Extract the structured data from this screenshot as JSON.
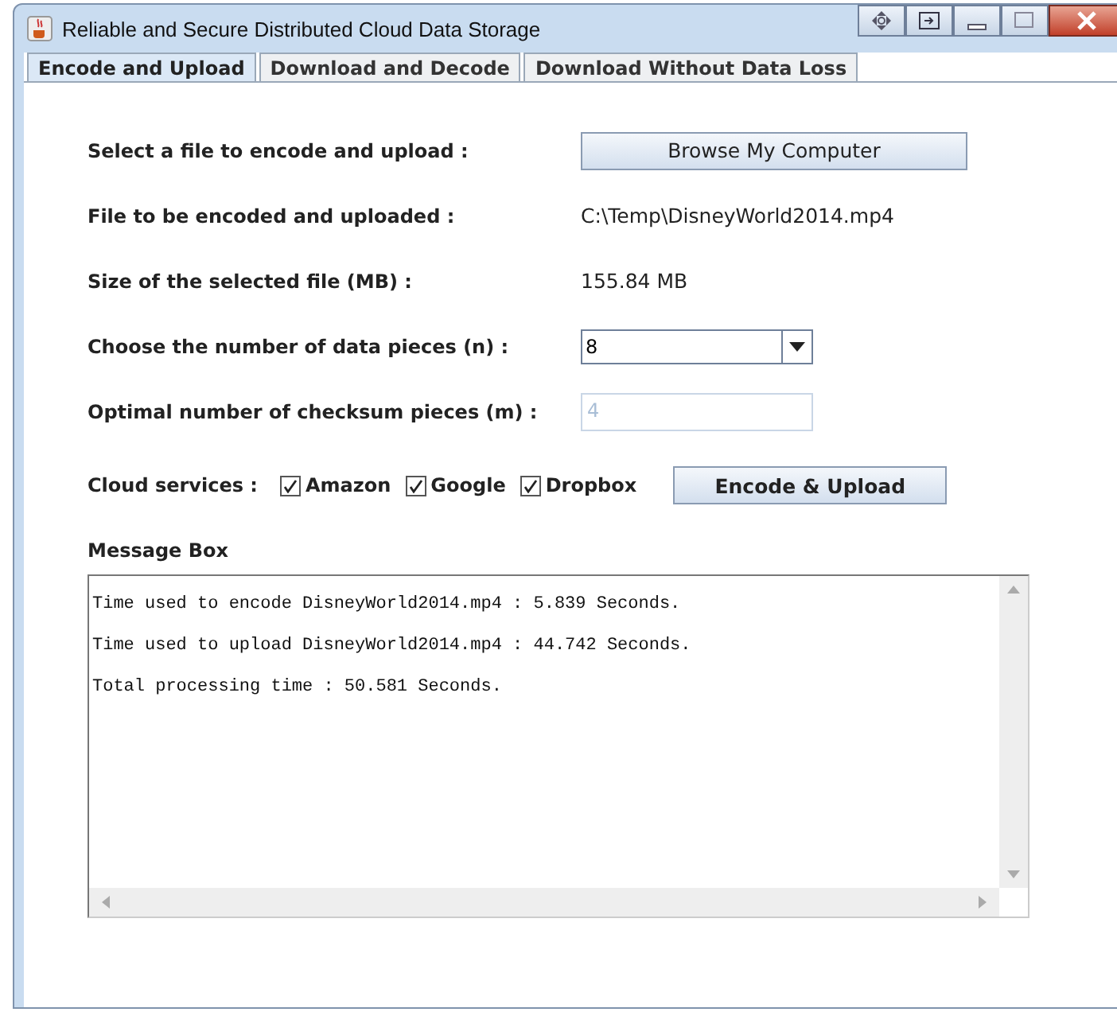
{
  "window": {
    "title": "Reliable and Secure Distributed Cloud Data Storage"
  },
  "tabs": [
    {
      "label": "Encode and Upload",
      "selected": true
    },
    {
      "label": "Download and Decode",
      "selected": false
    },
    {
      "label": "Download Without Data Loss",
      "selected": false
    }
  ],
  "form": {
    "select_label": "Select a file to encode and upload :",
    "browse_button": "Browse My Computer",
    "file_label": "File to be encoded and uploaded :",
    "file_value": "C:\\Temp\\DisneyWorld2014.mp4",
    "size_label": "Size of the selected file (MB) :",
    "size_value": "155.84 MB",
    "pieces_label": "Choose the number of data pieces (n) :",
    "pieces_value": "8",
    "checksum_label": "Optimal number of checksum pieces (m) :",
    "checksum_value": "4",
    "checksum_disabled": true
  },
  "cloud_label": "Cloud services :",
  "services": [
    {
      "label": "Amazon",
      "checked": true
    },
    {
      "label": "Google",
      "checked": true
    },
    {
      "label": "Dropbox",
      "checked": true
    }
  ],
  "encode_button": "Encode & Upload",
  "message_box": {
    "title": "Message Box",
    "lines": [
      "Time used to encode DisneyWorld2014.mp4 : 5.839 Seconds.",
      "Time used to upload DisneyWorld2014.mp4 : 44.742 Seconds.",
      "Total processing time : 50.581 Seconds."
    ]
  }
}
